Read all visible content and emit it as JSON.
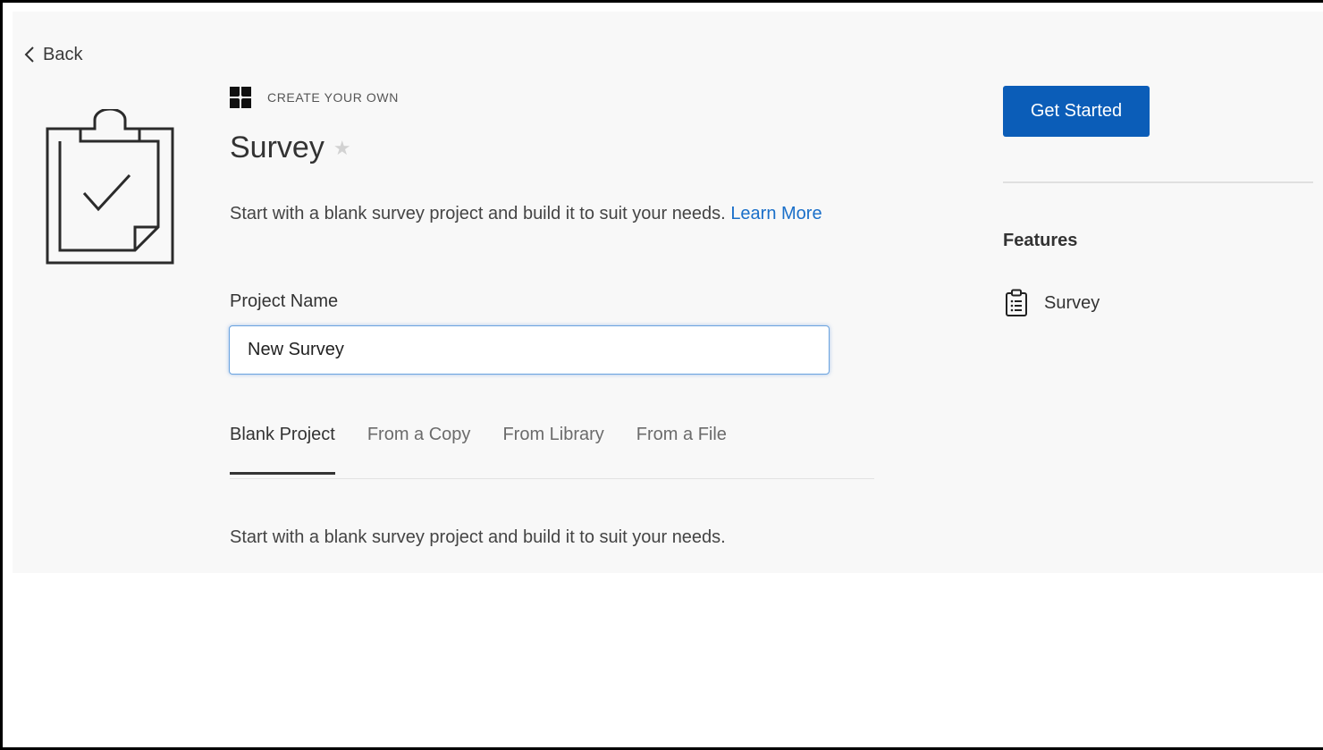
{
  "nav": {
    "back_label": "Back"
  },
  "project": {
    "kicker": "CREATE YOUR OWN",
    "title": "Survey",
    "description": "Start with a blank survey project and build it to suit your needs.",
    "learn_more": "Learn More"
  },
  "form": {
    "project_name_label": "Project Name",
    "project_name_value": "New Survey"
  },
  "tabs": [
    {
      "label": "Blank Project",
      "active": true
    },
    {
      "label": "From a Copy",
      "active": false
    },
    {
      "label": "From Library",
      "active": false
    },
    {
      "label": "From a File",
      "active": false
    }
  ],
  "tab_content": {
    "description": "Start with a blank survey project and build it to suit your needs."
  },
  "sidebar": {
    "cta_label": "Get Started",
    "features_heading": "Features",
    "features": [
      {
        "label": "Survey",
        "icon": "clipboard-list-icon"
      }
    ]
  },
  "colors": {
    "accent": "#0b5db8",
    "link": "#1a6fc9",
    "panel_bg": "#f8f8f8"
  }
}
